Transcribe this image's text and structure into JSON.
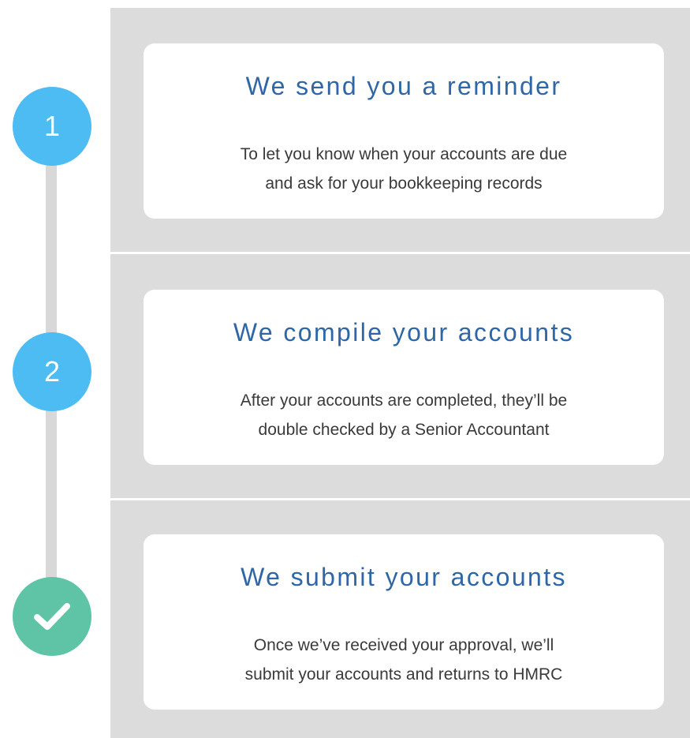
{
  "steps": [
    {
      "number": "1",
      "title": "We send you a reminder",
      "description_line1": "To let you know when your accounts are due",
      "description_line2": "and ask for your bookkeeping records"
    },
    {
      "number": "2",
      "title": "We compile your accounts",
      "description_line1": "After your accounts are completed, they’ll be",
      "description_line2": "double checked by a Senior Accountant"
    },
    {
      "number": "check",
      "title": "We submit your accounts",
      "description_line1": "Once we’ve received your approval, we’ll",
      "description_line2": "submit your accounts and returns to HMRC"
    }
  ],
  "colors": {
    "band": "#dcdcdc",
    "title": "#2e66a6",
    "step_circle": "#4cbcf2",
    "complete_circle": "#5ec4a5",
    "timeline": "#d8d8d8"
  },
  "icons": {
    "final_step": "checkmark-icon"
  }
}
